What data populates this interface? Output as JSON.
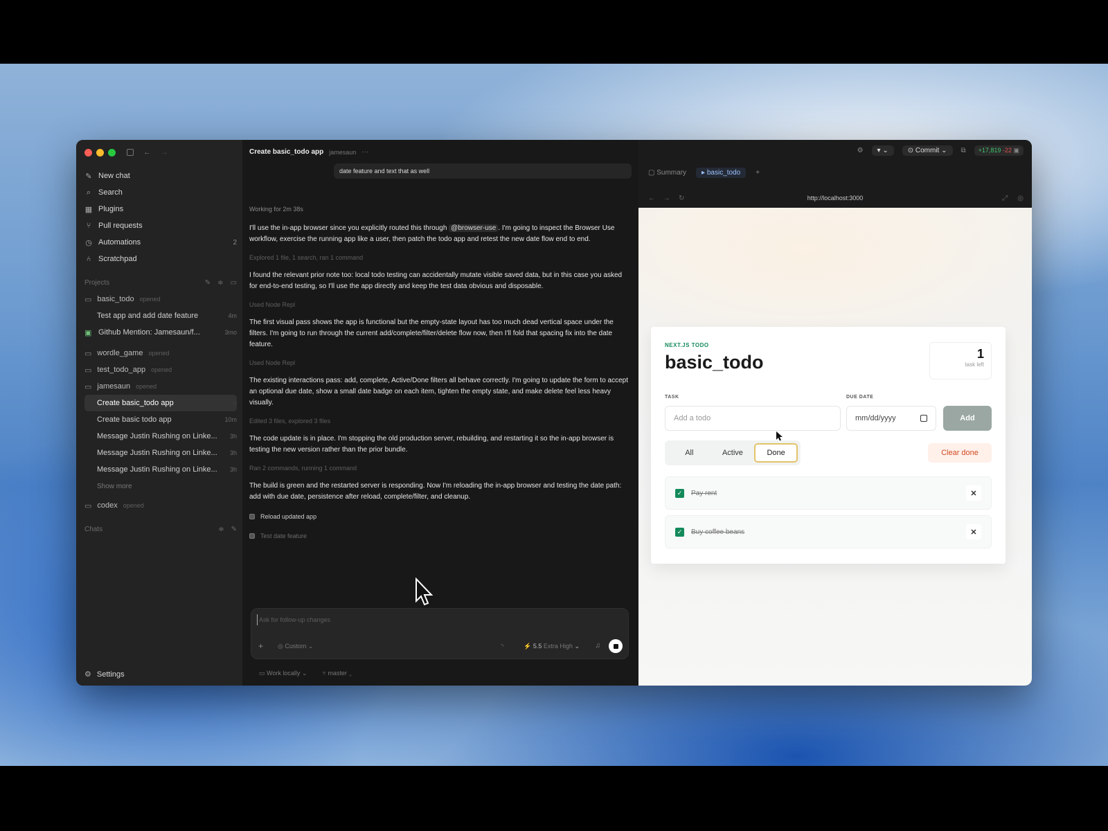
{
  "sidebar": {
    "nav": [
      {
        "label": "New chat",
        "icon": "compose-icon"
      },
      {
        "label": "Search",
        "icon": "search-icon"
      },
      {
        "label": "Plugins",
        "icon": "grid-icon"
      },
      {
        "label": "Pull requests",
        "icon": "git-pr-icon"
      },
      {
        "label": "Automations",
        "icon": "clock-icon",
        "badge": "2"
      },
      {
        "label": "Scratchpad",
        "icon": "branch-icon"
      }
    ],
    "projects_label": "Projects",
    "projects": [
      {
        "name": "basic_todo",
        "meta": "opened"
      },
      {
        "name": "wordle_game",
        "meta": "opened"
      },
      {
        "name": "test_todo_app",
        "meta": "opened"
      },
      {
        "name": "jamesaun",
        "meta": "opened"
      },
      {
        "name": "codex",
        "meta": "opened"
      }
    ],
    "basic_todo_threads": [
      {
        "label": "Test app and add date feature",
        "time": "4m"
      },
      {
        "label": "Github Mention: Jamesaun/f...",
        "time": "3mo"
      }
    ],
    "jamesaun_threads": [
      {
        "label": "Create basic_todo app",
        "time": ""
      },
      {
        "label": "Create basic todo app",
        "time": "10m"
      },
      {
        "label": "Message Justin Rushing on Linke...",
        "time": "3h"
      },
      {
        "label": "Message Justin Rushing on Linke...",
        "time": "3h"
      },
      {
        "label": "Message Justin Rushing on Linke...",
        "time": "3h"
      }
    ],
    "show_more": "Show more",
    "chats_label": "Chats",
    "settings": "Settings"
  },
  "chat": {
    "title": "Create basic_todo app",
    "project": "jamesaun",
    "more": "···",
    "user_message": "date feature and text that as well",
    "working": "Working for 2m 38s",
    "p1_a": "I'll use the in-app browser since you explicitly routed this through ",
    "p1_mention": "@browser-use",
    "p1_b": ". I'm going to inspect the Browser Use workflow, exercise the running app like a user, then patch the todo app and retest the new date flow end to end.",
    "step1": "Explored 1 file, 1 search, ran 1 command",
    "p2": "I found the relevant prior note too: local todo testing can accidentally mutate visible saved data, but in this case you asked for end-to-end testing, so I'll use the app directly and keep the test data obvious and disposable.",
    "step2": "Used Node Repl",
    "p3": "The first visual pass shows the app is functional but the empty-state layout has too much dead vertical space under the filters. I'm going to run through the current add/complete/filter/delete flow now, then I'll fold that spacing fix into the date feature.",
    "step3": "Used Node Repl",
    "p4": "The existing interactions pass: add, complete, Active/Done filters all behave correctly. I'm going to update the form to accept an optional due date, show a small date badge on each item, tighten the empty state, and make delete feel less heavy visually.",
    "step4": "Edited 3 files, explored 3 files",
    "p5": "The code update is in place. I'm stopping the old production server, rebuilding, and restarting it so the in-app browser is testing the new version rather than the prior bundle.",
    "step5": "Ran 2 commands, running 1 command",
    "p6": "The build is green and the restarted server is responding. Now I'm reloading the in-app browser and testing the date path: add with due date, persistence after reload, complete/filter, and cleanup.",
    "todos": [
      "Reload updated app",
      "Test date feature"
    ],
    "composer_placeholder": "Ask for follow-up changes",
    "mode": "Custom",
    "model": "5.5",
    "level": "Extra High",
    "footer_left": "Work locally",
    "footer_right": "master"
  },
  "right": {
    "commit": "Commit",
    "diff_add": "+17,819",
    "diff_del": "-22",
    "tab_summary": "Summary",
    "tab_app": "basic_todo",
    "url": "http://localhost:3000"
  },
  "todo_app": {
    "eyebrow": "NEXT.JS TODO",
    "title": "basic_todo",
    "count": "1",
    "count_label": "task left",
    "task_label": "TASK",
    "task_placeholder": "Add a todo",
    "due_label": "DUE DATE",
    "date_placeholder": "mm/dd/yyyy",
    "add": "Add",
    "filters": [
      "All",
      "Active",
      "Done"
    ],
    "clear": "Clear done",
    "items": [
      {
        "text": "Pay rent",
        "done": true
      },
      {
        "text": "Buy coffee beans",
        "done": true
      }
    ],
    "accent": "#138a5a",
    "clear_color": "#d3481f"
  }
}
